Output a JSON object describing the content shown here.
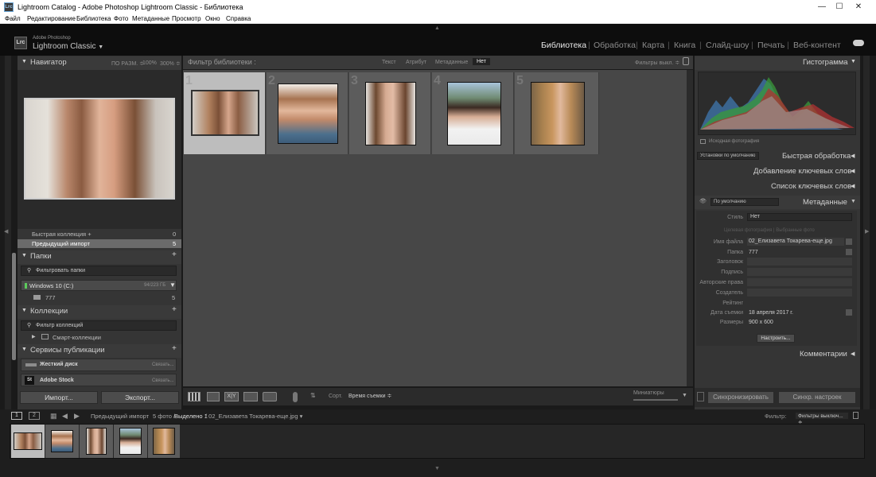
{
  "titlebar": {
    "title": "Lightroom Catalog - Adobe Photoshop Lightroom Classic - Библиотека",
    "app_icon": "Lrc",
    "minimize": "—",
    "maximize": "☐",
    "close": "✕"
  },
  "menu": [
    "Файл",
    "Редактирование",
    "Библиотека",
    "Фото",
    "Метаданные",
    "Просмотр",
    "Окно",
    "Справка"
  ],
  "brand": {
    "logo": "Lrc",
    "line1": "Adobe Photoshop",
    "line2": "Lightroom Classic",
    "caret": "▼"
  },
  "modules": [
    {
      "label": "Библиотека",
      "active": true
    },
    {
      "label": "Обработка"
    },
    {
      "label": "Карта"
    },
    {
      "label": "Книга"
    },
    {
      "label": "Слайд-шоу"
    },
    {
      "label": "Печать"
    },
    {
      "label": "Веб-контент"
    }
  ],
  "navigator": {
    "title": "Навигатор",
    "fit": "ПО РАЗМ. ≑",
    "z100": "100%",
    "z300": "300% ≑"
  },
  "catalog": {
    "quick": "Быстрая коллекция +",
    "quick_count": "0",
    "previous": "Предыдущий импорт",
    "previous_count": "5"
  },
  "folders": {
    "title": "Папки",
    "filter": "Фильтровать папки",
    "volume": "Windows 10 (C:)",
    "volume_info": "94/223 ГБ",
    "folder": "777",
    "folder_count": "5"
  },
  "collections": {
    "title": "Коллекции",
    "filter": "Фильтр коллекций",
    "smart": "Смарт-коллекции"
  },
  "publish": {
    "title": "Сервисы публикации",
    "hd": "Жесткий диск",
    "hd_action": "Связать...",
    "stock": "Adobe Stock",
    "stock_action": "Связать..."
  },
  "import_btn": "Импорт...",
  "export_btn": "Экспорт...",
  "filterbar": {
    "title": "Фильтр библиотеки :",
    "text": "Текст",
    "attr": "Атрибут",
    "meta": "Метаданные",
    "none": "Нет",
    "presets": "Фильтры выкл. ≑"
  },
  "grid": {
    "numbers": [
      "1",
      "2",
      "3",
      "4",
      "5"
    ]
  },
  "toolbar": {
    "sort_label": "Сорт.",
    "sort_value": "Время съемки ≑",
    "thumbs": "Миниатюры"
  },
  "histogram": {
    "title": "Гистограмма",
    "original": "Исходная фотография"
  },
  "quick_develop": {
    "preset": "Установки по умолчанию",
    "title": "Быстрая обработка"
  },
  "keywording": {
    "title": "Добавление ключевых слов"
  },
  "keyword_list": {
    "title": "Список ключевых слов"
  },
  "metadata": {
    "title": "Метаданные",
    "preset": "По умолчанию",
    "style_label": "Стиль",
    "style_value": "Нет",
    "tabs": "Целевая фотография   |   Выбранные фото",
    "rows": [
      {
        "label": "Имя файла",
        "value": "02_Елизавета Токарева-еще.jpg"
      },
      {
        "label": "Папка",
        "value": "777"
      },
      {
        "label": "Заголовок",
        "value": ""
      },
      {
        "label": "Подпись",
        "value": ""
      },
      {
        "label": "Авторские права",
        "value": ""
      },
      {
        "label": "Создатель",
        "value": ""
      },
      {
        "label": "Рейтинг",
        "value": ""
      },
      {
        "label": "Дата съемки",
        "value": "18 апреля 2017 г."
      },
      {
        "label": "Размеры",
        "value": "900 x 600"
      }
    ],
    "customize": "Настроить..."
  },
  "comments": {
    "title": "Комментарии"
  },
  "sync_btn": "Синхронизировать",
  "sync_settings_btn": "Синхр. настроек",
  "filmstrip": {
    "s1": "1",
    "s2": "2",
    "source": "Предыдущий импорт",
    "count": "5 фото /",
    "selected": "Выделено 1",
    "path": "/ 02_Елизавета Токарева-еще.jpg ▾",
    "filter_label": "Фильтр:",
    "filter_value": "Фильтры выключ... ≑"
  }
}
